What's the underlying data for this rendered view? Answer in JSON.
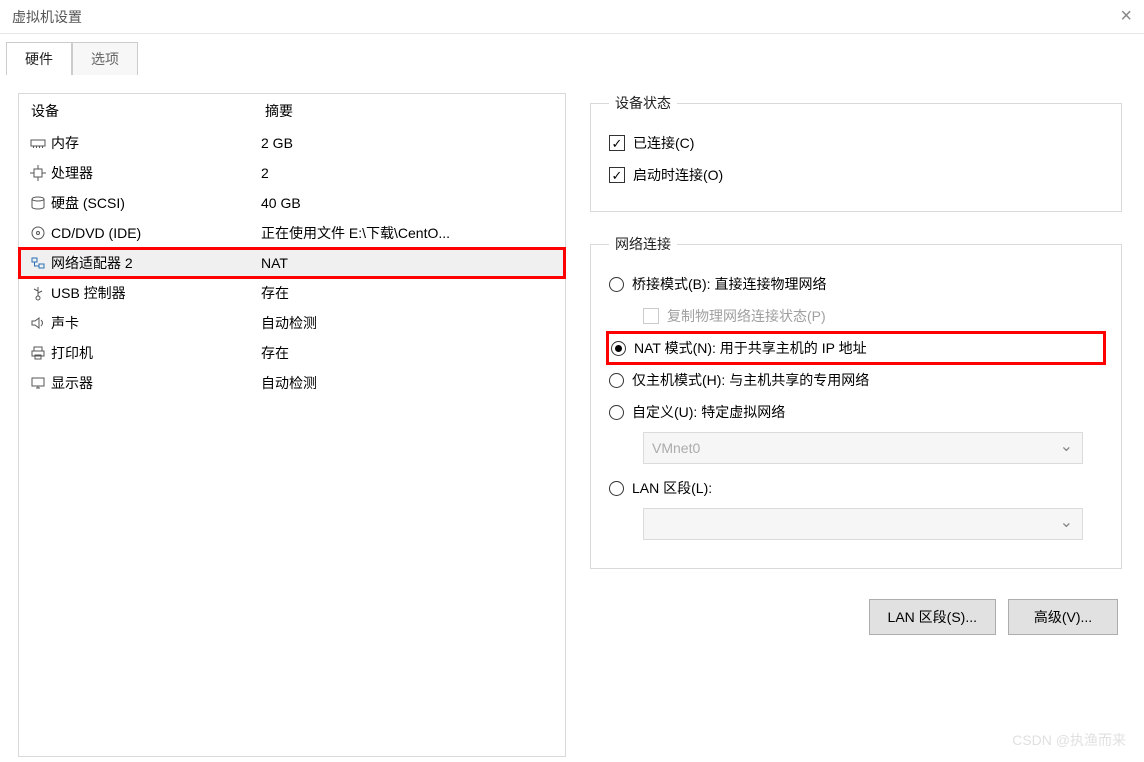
{
  "window": {
    "title": "虚拟机设置"
  },
  "tabs": {
    "hardware": "硬件",
    "options": "选项"
  },
  "device_table": {
    "header_device": "设备",
    "header_summary": "摘要",
    "rows": [
      {
        "icon": "memory-icon",
        "name": "内存",
        "summary": "2 GB",
        "selected": false,
        "highlighted": false
      },
      {
        "icon": "cpu-icon",
        "name": "处理器",
        "summary": "2",
        "selected": false,
        "highlighted": false
      },
      {
        "icon": "disk-icon",
        "name": "硬盘 (SCSI)",
        "summary": "40 GB",
        "selected": false,
        "highlighted": false
      },
      {
        "icon": "cd-icon",
        "name": "CD/DVD (IDE)",
        "summary": "正在使用文件 E:\\下载\\CentO...",
        "selected": false,
        "highlighted": false
      },
      {
        "icon": "network-icon",
        "name": "网络适配器 2",
        "summary": "NAT",
        "selected": true,
        "highlighted": true
      },
      {
        "icon": "usb-icon",
        "name": "USB 控制器",
        "summary": "存在",
        "selected": false,
        "highlighted": false
      },
      {
        "icon": "sound-icon",
        "name": "声卡",
        "summary": "自动检测",
        "selected": false,
        "highlighted": false
      },
      {
        "icon": "printer-icon",
        "name": "打印机",
        "summary": "存在",
        "selected": false,
        "highlighted": false
      },
      {
        "icon": "display-icon",
        "name": "显示器",
        "summary": "自动检测",
        "selected": false,
        "highlighted": false
      }
    ]
  },
  "device_status": {
    "legend": "设备状态",
    "connected": {
      "label": "已连接(C)",
      "checked": true
    },
    "connect_at_power_on": {
      "label": "启动时连接(O)",
      "checked": true
    }
  },
  "network_connection": {
    "legend": "网络连接",
    "bridged": {
      "label": "桥接模式(B): 直接连接物理网络",
      "checked": false
    },
    "replicate": {
      "label": "复制物理网络连接状态(P)",
      "checked": false,
      "disabled": true
    },
    "nat": {
      "label": "NAT 模式(N): 用于共享主机的 IP 地址",
      "checked": true,
      "highlighted": true
    },
    "hostonly": {
      "label": "仅主机模式(H): 与主机共享的专用网络",
      "checked": false
    },
    "custom": {
      "label": "自定义(U): 特定虚拟网络",
      "checked": false
    },
    "custom_select": {
      "value": "VMnet0",
      "disabled": true
    },
    "lan_segment": {
      "label": "LAN 区段(L):",
      "checked": false
    },
    "lan_select": {
      "value": "",
      "disabled": true
    }
  },
  "buttons": {
    "lan_segments": "LAN 区段(S)...",
    "advanced": "高级(V)..."
  },
  "watermark": "CSDN @执渔而来"
}
